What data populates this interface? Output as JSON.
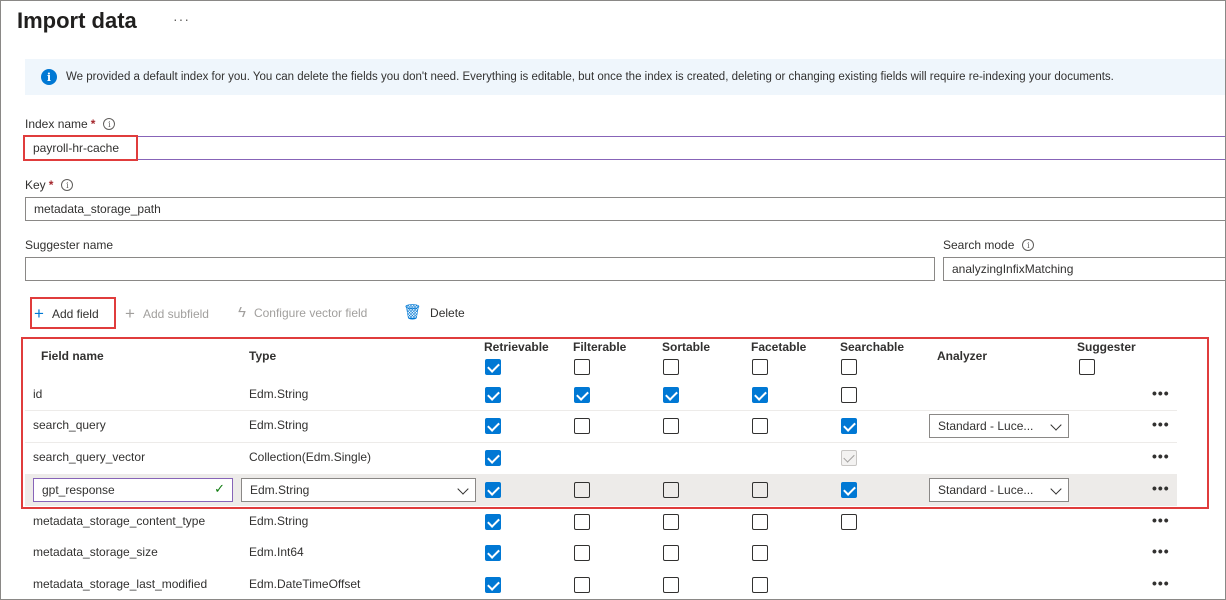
{
  "page": {
    "title": "Import data",
    "more_label": "···"
  },
  "info": {
    "icon": "info-icon",
    "text": "We provided a default index for you. You can delete the fields you don't need. Everything is editable, but once the index is created, deleting or changing existing fields will require re-indexing your documents."
  },
  "index_name": {
    "label": "Index name",
    "required": "*",
    "value": "payroll-hr-cache"
  },
  "key": {
    "label": "Key",
    "required": "*",
    "value": "metadata_storage_path"
  },
  "suggester_name": {
    "label": "Suggester name",
    "value": ""
  },
  "search_mode": {
    "label": "Search mode",
    "value": "analyzingInfixMatching"
  },
  "toolbar": {
    "add_field": "Add field",
    "add_subfield": "Add subfield",
    "configure_vector_field": "Configure vector field",
    "delete": "Delete"
  },
  "table": {
    "headers": {
      "field_name": "Field name",
      "type": "Type",
      "retrievable": "Retrievable",
      "filterable": "Filterable",
      "sortable": "Sortable",
      "facetable": "Facetable",
      "searchable": "Searchable",
      "analyzer": "Analyzer",
      "suggester": "Suggester"
    },
    "header_checks": {
      "retrievable": true,
      "filterable": false,
      "sortable": false,
      "facetable": false,
      "searchable": false,
      "suggester": false
    },
    "rows": [
      {
        "name": "id",
        "type": "Edm.String",
        "retrievable": "on",
        "filterable": "on",
        "sortable": "on",
        "facetable": "on",
        "searchable": "off",
        "analyzer": ""
      },
      {
        "name": "search_query",
        "type": "Edm.String",
        "retrievable": "on",
        "filterable": "off",
        "sortable": "off",
        "facetable": "off",
        "searchable": "on",
        "analyzer": "Standard - Luce..."
      },
      {
        "name": "search_query_vector",
        "type": "Collection(Edm.Single)",
        "retrievable": "on",
        "filterable": "none",
        "sortable": "none",
        "facetable": "none",
        "searchable": "disabled",
        "analyzer": ""
      },
      {
        "name": "gpt_response",
        "type": "Edm.String",
        "retrievable": "on",
        "filterable": "off",
        "sortable": "off",
        "facetable": "off",
        "searchable": "on",
        "analyzer": "Standard - Luce..."
      },
      {
        "name": "metadata_storage_content_type",
        "type": "Edm.String",
        "retrievable": "on",
        "filterable": "off",
        "sortable": "off",
        "facetable": "off",
        "searchable": "off",
        "analyzer": ""
      },
      {
        "name": "metadata_storage_size",
        "type": "Edm.Int64",
        "retrievable": "on",
        "filterable": "off",
        "sortable": "off",
        "facetable": "off",
        "searchable": "none",
        "analyzer": ""
      },
      {
        "name": "metadata_storage_last_modified",
        "type": "Edm.DateTimeOffset",
        "retrievable": "on",
        "filterable": "off",
        "sortable": "off",
        "facetable": "off",
        "searchable": "none",
        "analyzer": ""
      }
    ],
    "row_more": "•••"
  },
  "colors": {
    "accent": "#0078d4",
    "highlight_border": "#e03c3c",
    "valid_check": "#107c10"
  }
}
